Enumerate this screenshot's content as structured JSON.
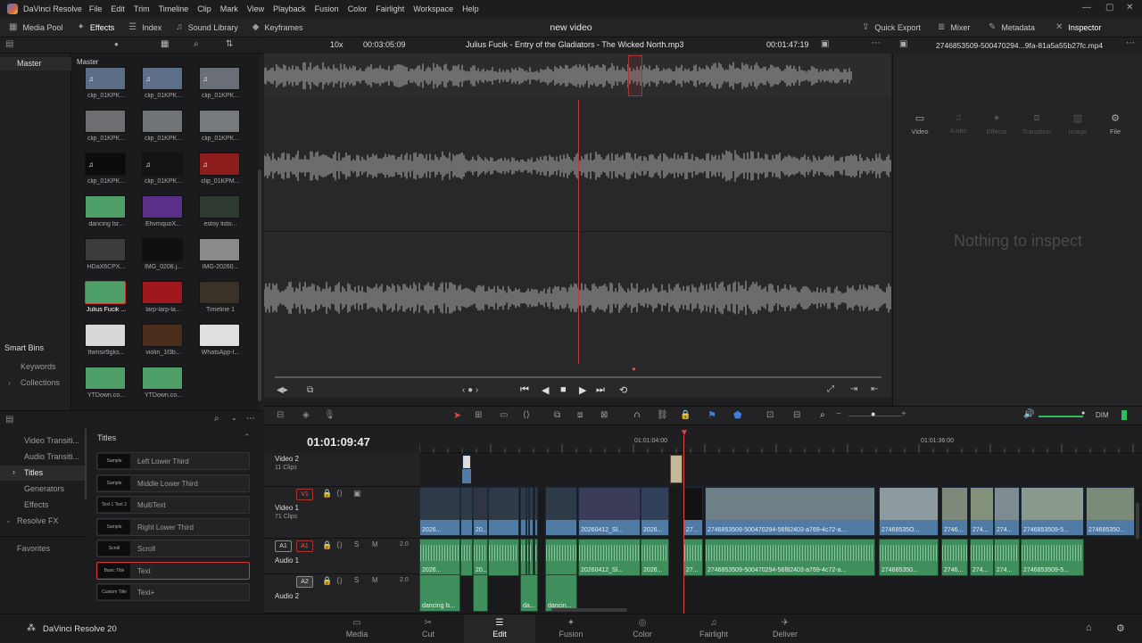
{
  "menubar": {
    "app_name": "DaVinci Resolve",
    "items": [
      "File",
      "Edit",
      "Trim",
      "Timeline",
      "Clip",
      "Mark",
      "View",
      "Playback",
      "Fusion",
      "Color",
      "Fairlight",
      "Workspace",
      "Help"
    ]
  },
  "toolbar": {
    "media_pool": "Media Pool",
    "effects": "Effects",
    "index": "Index",
    "sound_library": "Sound Library",
    "keyframes": "Keyframes",
    "project_title": "new video",
    "quick_export": "Quick Export",
    "mixer": "Mixer",
    "metadata": "Metadata",
    "inspector": "Inspector"
  },
  "media": {
    "sidebar_master": "Master",
    "bin_title": "Master",
    "smart_bins": "Smart Bins",
    "keywords": "Keywords",
    "collections": "Collections",
    "clips": [
      {
        "name": "clip_01KPK...",
        "color": "#5a6e86",
        "audio": true
      },
      {
        "name": "clip_01KPK...",
        "color": "#5d6f88",
        "audio": true
      },
      {
        "name": "clip_01KPK...",
        "color": "#6a6e76",
        "audio": true
      },
      {
        "name": "clip_01KPK...",
        "color": "#6d6f73",
        "audio": false
      },
      {
        "name": "clip_01KPK...",
        "color": "#71757a",
        "audio": false
      },
      {
        "name": "clip_01KPK...",
        "color": "#777a7f",
        "audio": false
      },
      {
        "name": "clip_01KPK...",
        "color": "#0c0c0c",
        "audio": true
      },
      {
        "name": "clip_01KPK...",
        "color": "#141414",
        "audio": true
      },
      {
        "name": "clip_01KPM...",
        "color": "#8e1d1d",
        "audio": true
      },
      {
        "name": "dancing lsr...",
        "color": "#4fa068",
        "audio": false
      },
      {
        "name": "EhvmquoX...",
        "color": "#5a2f8a",
        "audio": false
      },
      {
        "name": "estoy listo...",
        "color": "#2e3a30",
        "audio": false
      },
      {
        "name": "HDaX6CPX...",
        "color": "#3c3c3c",
        "audio": false
      },
      {
        "name": "IMG_0208.j...",
        "color": "#101010",
        "audio": false
      },
      {
        "name": "IMG-20260...",
        "color": "#8a8a8a",
        "audio": false
      },
      {
        "name": "Julius Fucik ...",
        "color": "#4fa068",
        "audio": false
      },
      {
        "name": "larp-larp-la...",
        "color": "#a0171c",
        "audio": false
      },
      {
        "name": "Timeline 1",
        "color": "#3a3226",
        "audio": false
      },
      {
        "name": "ttwnsir9gks...",
        "color": "#d8d8d8",
        "audio": false
      },
      {
        "name": "violin_1f3b...",
        "color": "#4a2d1a",
        "audio": false
      },
      {
        "name": "WhatsApp-I...",
        "color": "#e0e0e0",
        "audio": false
      },
      {
        "name": "YTDown.co...",
        "color": "#4fa068",
        "audio": false
      },
      {
        "name": "YTDown.co...",
        "color": "#4fa068",
        "audio": false
      }
    ]
  },
  "viewer": {
    "zoom": "10x",
    "timecode_left": "00:03:05:09",
    "clip_title": "Julius Fucik - Entry of the Gladiators - The Wicked North.mp3",
    "timecode_right": "00:01:47:19"
  },
  "inspector": {
    "file_title": "2746853509-500470294...9fa-81a5a55b27fc.mp4",
    "tabs": [
      "Video",
      "Audio",
      "Effects",
      "Transition",
      "Image",
      "File"
    ],
    "empty_message": "Nothing to inspect"
  },
  "effects": {
    "categories": [
      "Video Transiti...",
      "Audio Transiti...",
      "Titles",
      "Generators",
      "Effects",
      "Resolve FX"
    ],
    "favorites": "Favorites",
    "section_title": "Titles",
    "titles": [
      {
        "name": "Left Lower Third",
        "thumb": "Sample"
      },
      {
        "name": "Middle Lower Third",
        "thumb": "Sample"
      },
      {
        "name": "MultiText",
        "thumb": "Text 1 Text 2"
      },
      {
        "name": "Right Lower Third",
        "thumb": "Sample"
      },
      {
        "name": "Scroll",
        "thumb": "Scroll"
      },
      {
        "name": "Text",
        "thumb": "Basic Title"
      },
      {
        "name": "Text+",
        "thumb": "Custom Title"
      }
    ]
  },
  "timeline": {
    "timecode": "01:01:09:47",
    "ruler": [
      "01:01:04:00",
      "01:01:36:00"
    ],
    "dim": "DIM",
    "tracks": {
      "v2_name": "Video 2",
      "v2_count": "11 Clips",
      "v1_tag": "V1",
      "v1_name": "Video 1",
      "v1_count": "71 Clips",
      "a1_tag": "A1",
      "a1_name": "Audio 1",
      "a1_vol": "2.0",
      "a2_tag": "A2",
      "a2_name": "Audio 2",
      "a2_vol": "2.0"
    },
    "video_clips": [
      {
        "label": "2026...",
        "color": "#2e3a48"
      },
      {
        "label": "20...",
        "color": "#2f3642"
      },
      {
        "label": "20260412_Sl...",
        "color": "#3b3c58"
      },
      {
        "label": "2026...",
        "color": "#31415a"
      },
      {
        "label": "27...",
        "color": "#121212"
      },
      {
        "label": "2746853509-500470294-56f82403-a769-4c72-a...",
        "color": "#6f7f88"
      },
      {
        "label": "27468535O...",
        "color": "#8d9aa0"
      },
      {
        "label": "2746...",
        "color": "#7e8a7a"
      },
      {
        "label": "274...",
        "color": "#83917a"
      },
      {
        "label": "274...",
        "color": "#7e8c92"
      },
      {
        "label": "2746853509-5...",
        "color": "#8a9a8c"
      },
      {
        "label": "274685350...",
        "color": "#7a8c78"
      }
    ],
    "audio1_clips": [
      {
        "label": "2026..."
      },
      {
        "label": "20..."
      },
      {
        "label": "20260412_Sl..."
      },
      {
        "label": "2026..."
      },
      {
        "label": "27..."
      },
      {
        "label": "2746853509-500470294-56f82403-a769-4c72-a..."
      },
      {
        "label": "274685350..."
      },
      {
        "label": "2746..."
      },
      {
        "label": "274..."
      },
      {
        "label": "274..."
      },
      {
        "label": "2746853509-5..."
      }
    ],
    "audio2_clips": [
      {
        "label": "dancing ls..."
      },
      {
        "label": "da..."
      },
      {
        "label": "dancin..."
      }
    ]
  },
  "pages": [
    "Media",
    "Cut",
    "Edit",
    "Fusion",
    "Color",
    "Fairlight",
    "Deliver"
  ],
  "active_page": "Edit",
  "footer": {
    "app_version": "DaVinci Resolve 20"
  }
}
